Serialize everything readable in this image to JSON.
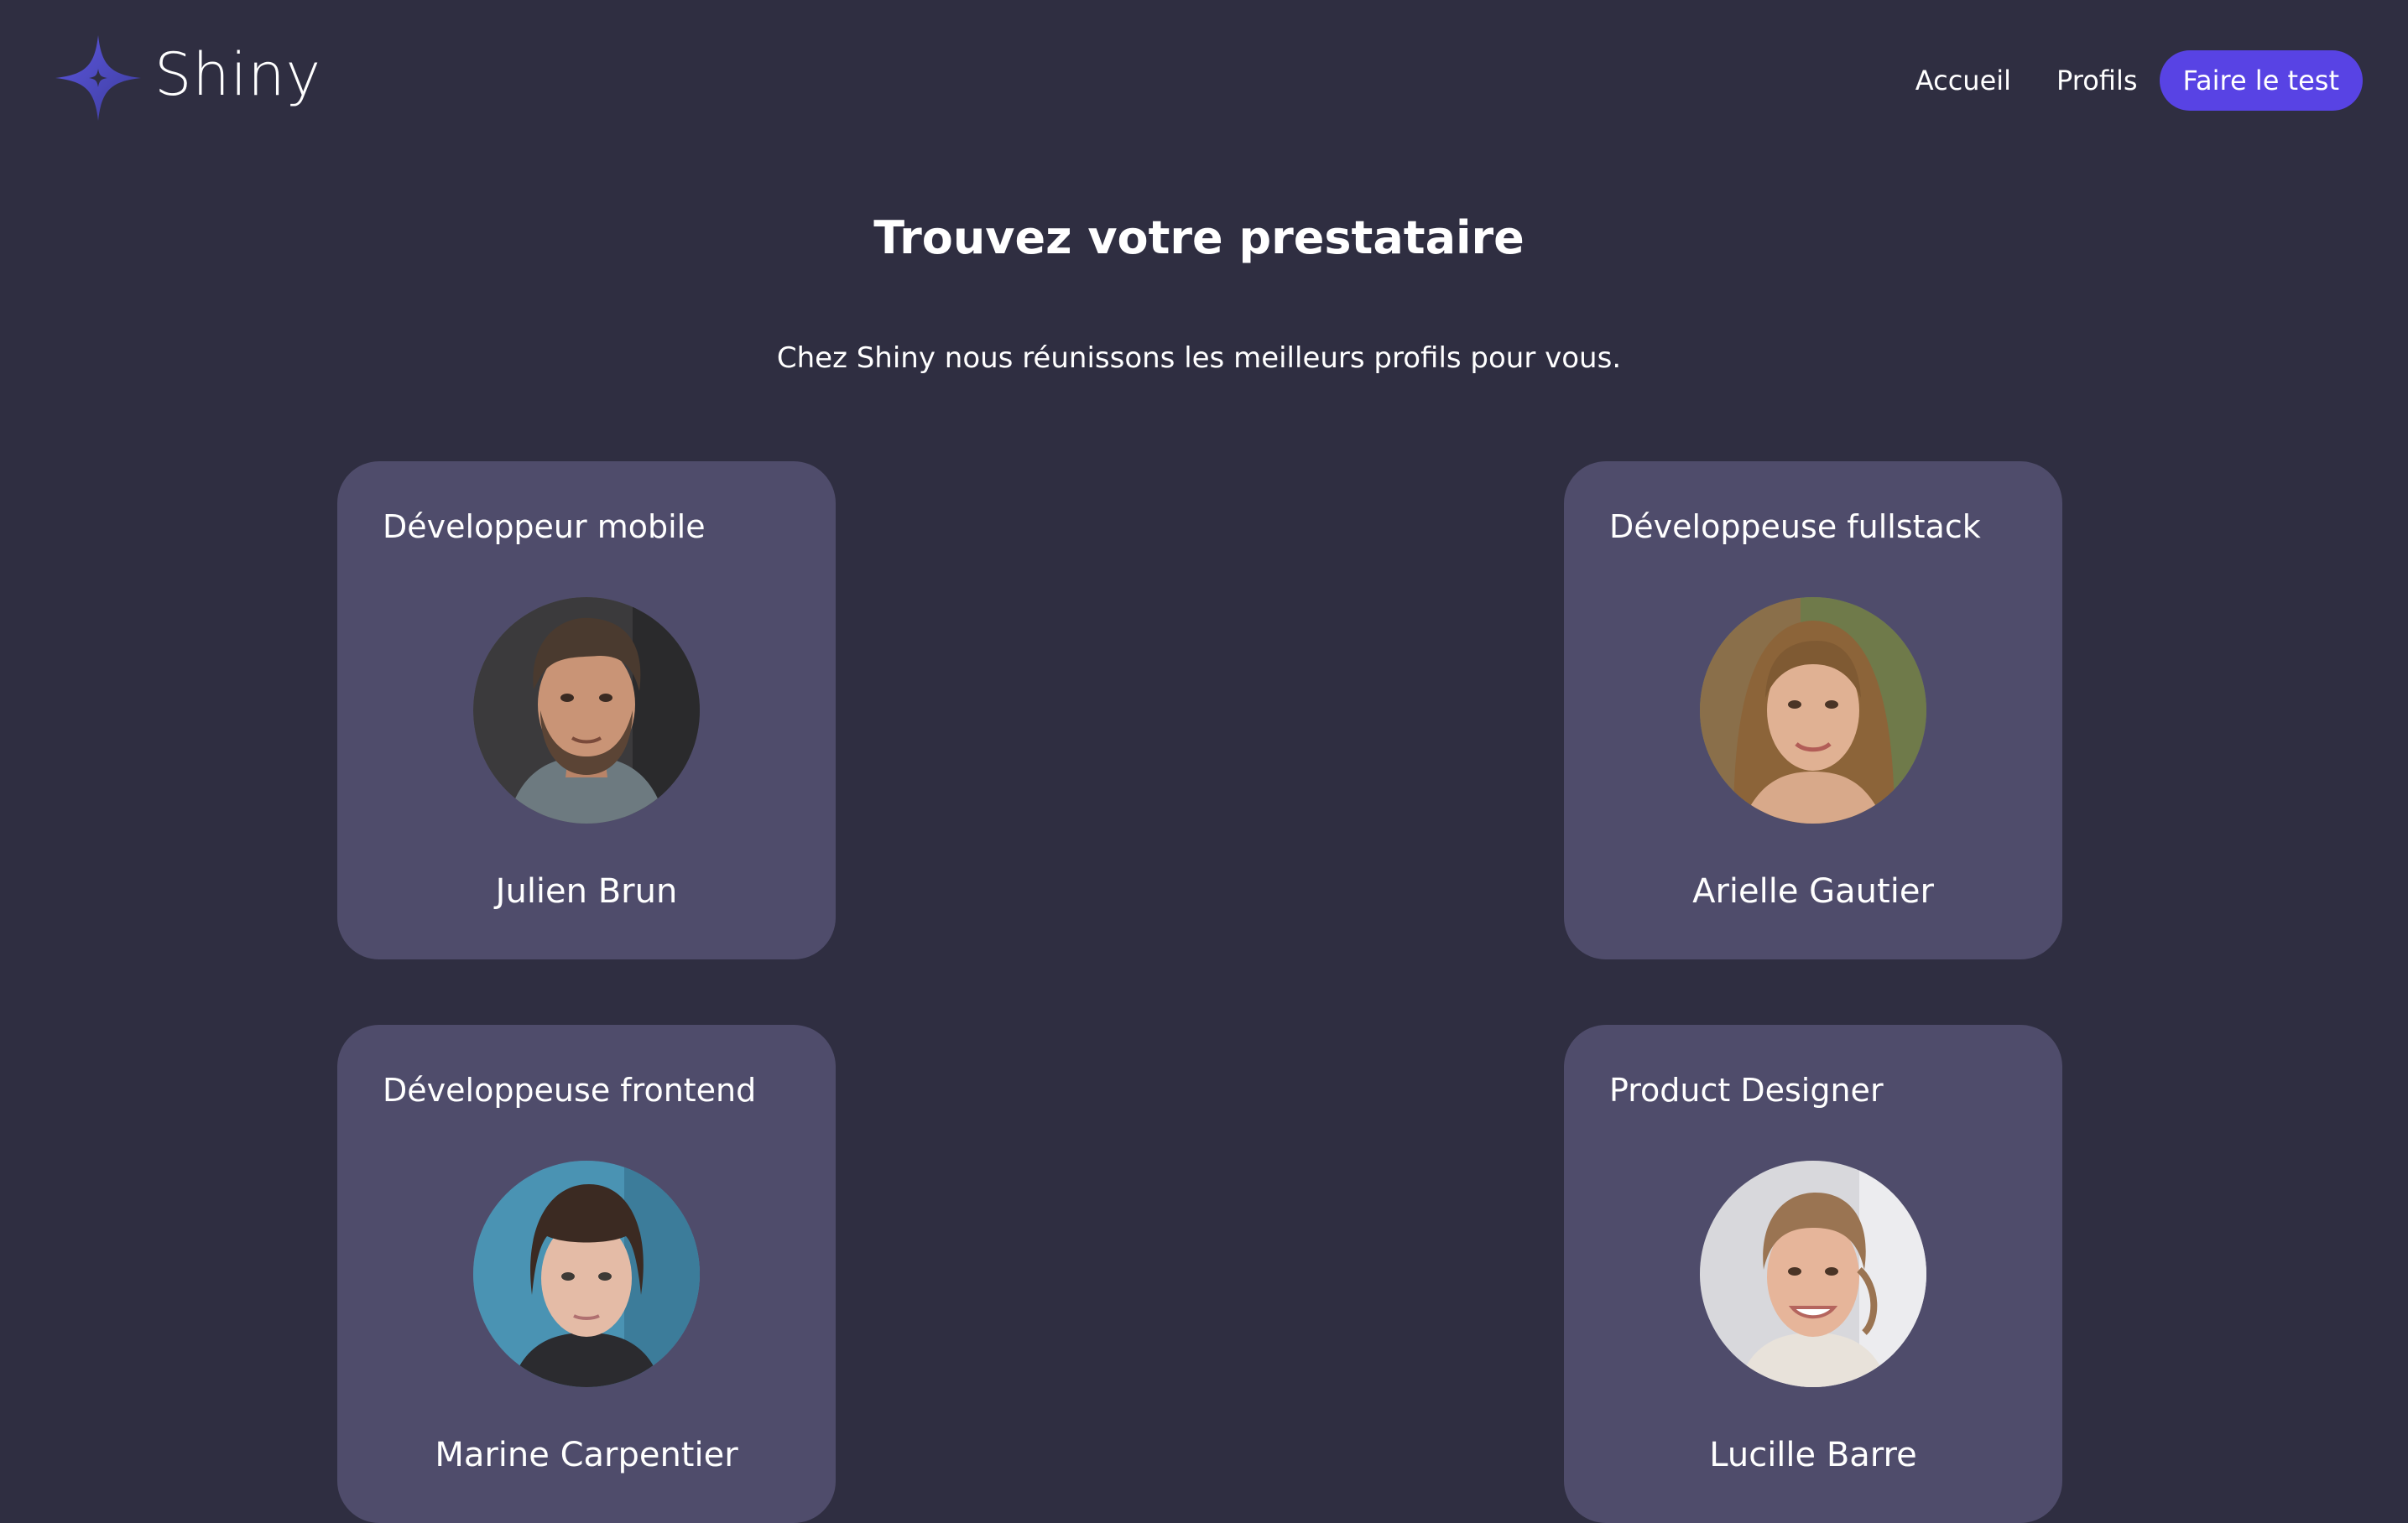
{
  "header": {
    "logo_text": "Shiny",
    "logo_icon": "sparkle-star-icon",
    "nav": {
      "home": "Accueil",
      "profiles": "Profils",
      "cta": "Faire le test"
    }
  },
  "main": {
    "title": "Trouvez votre prestataire",
    "subtitle": "Chez Shiny nous réunissons les meilleurs profils pour vous.",
    "cards": [
      {
        "job": "Développeur mobile",
        "name": "Julien Brun"
      },
      {
        "job": "Développeuse fullstack",
        "name": "Arielle Gautier"
      },
      {
        "job": "Développeuse frontend",
        "name": "Marine Carpentier"
      },
      {
        "job": "Product Designer",
        "name": "Lucille Barre"
      }
    ]
  },
  "colors": {
    "background": "#2f2e41",
    "card": "#4f4c6b",
    "accent": "#5843e4"
  }
}
